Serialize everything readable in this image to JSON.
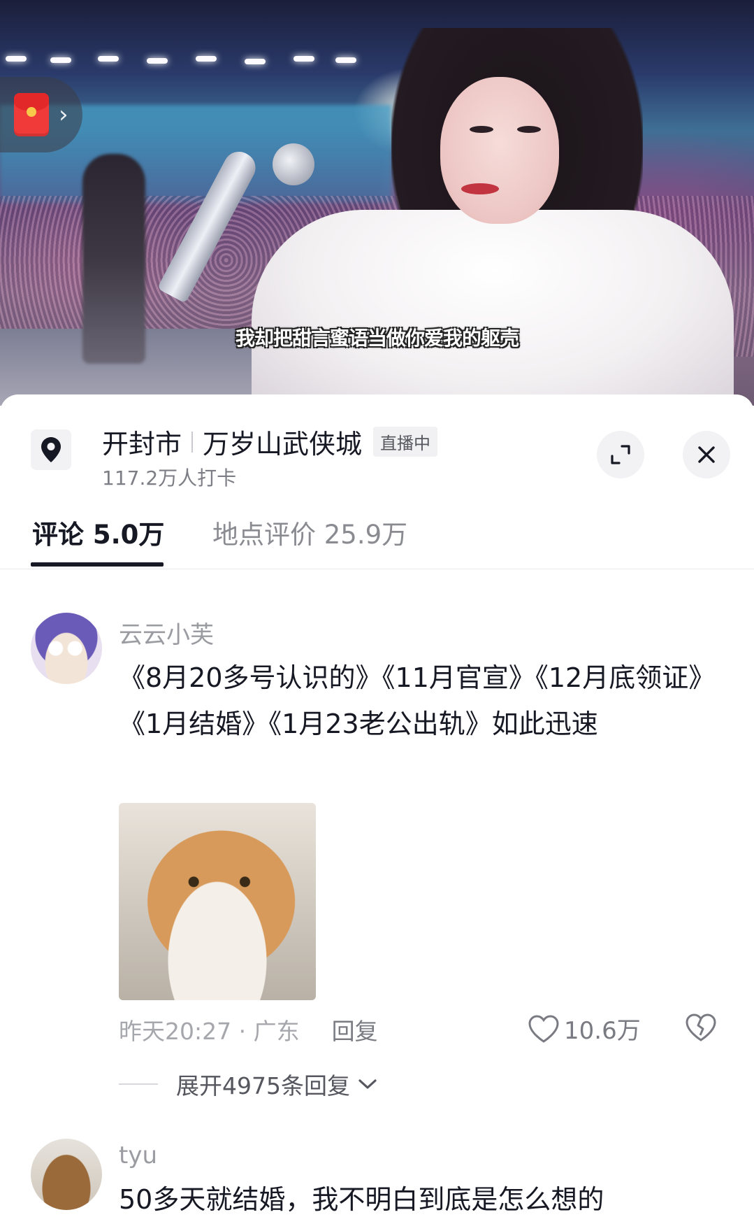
{
  "video": {
    "subtitle": "我却把甜言蜜语当做你爱我的躯壳",
    "redpack_icon": "red-envelope-icon",
    "redpack_arrow_icon": "chevron-right-icon",
    "redpack_arrow": "›"
  },
  "location": {
    "city": "开封市",
    "place": "万岁山武侠城",
    "live_badge": "直播中",
    "checkins": "117.2万人打卡",
    "pin_icon": "location-pin-icon",
    "expand_icon": "expand-icon",
    "close_icon": "close-icon"
  },
  "tabs": [
    {
      "label": "评论 5.0万",
      "active": true
    },
    {
      "label": "地点评价 25.9万",
      "active": false
    }
  ],
  "comments": [
    {
      "username": "云云小芙",
      "text": "《8月20多号认识的》《11月官宣》《12月底领证》《1月结婚》《1月23老公出轨》如此迅速",
      "has_image": true,
      "image_icon": "sad-cat-sticker",
      "time_location": "昨天20:27 · 广东",
      "reply_label": "回复",
      "likes": "10.6万",
      "expand_label": "展开4975条回复"
    },
    {
      "username": "tyu",
      "text": "50多天就结婚，我不明白到底是怎么想的"
    }
  ],
  "colors": {
    "text_primary": "#161823",
    "text_secondary": "#9b9ca1",
    "active_underline": "#161823",
    "redpack": "#f03a3a"
  }
}
